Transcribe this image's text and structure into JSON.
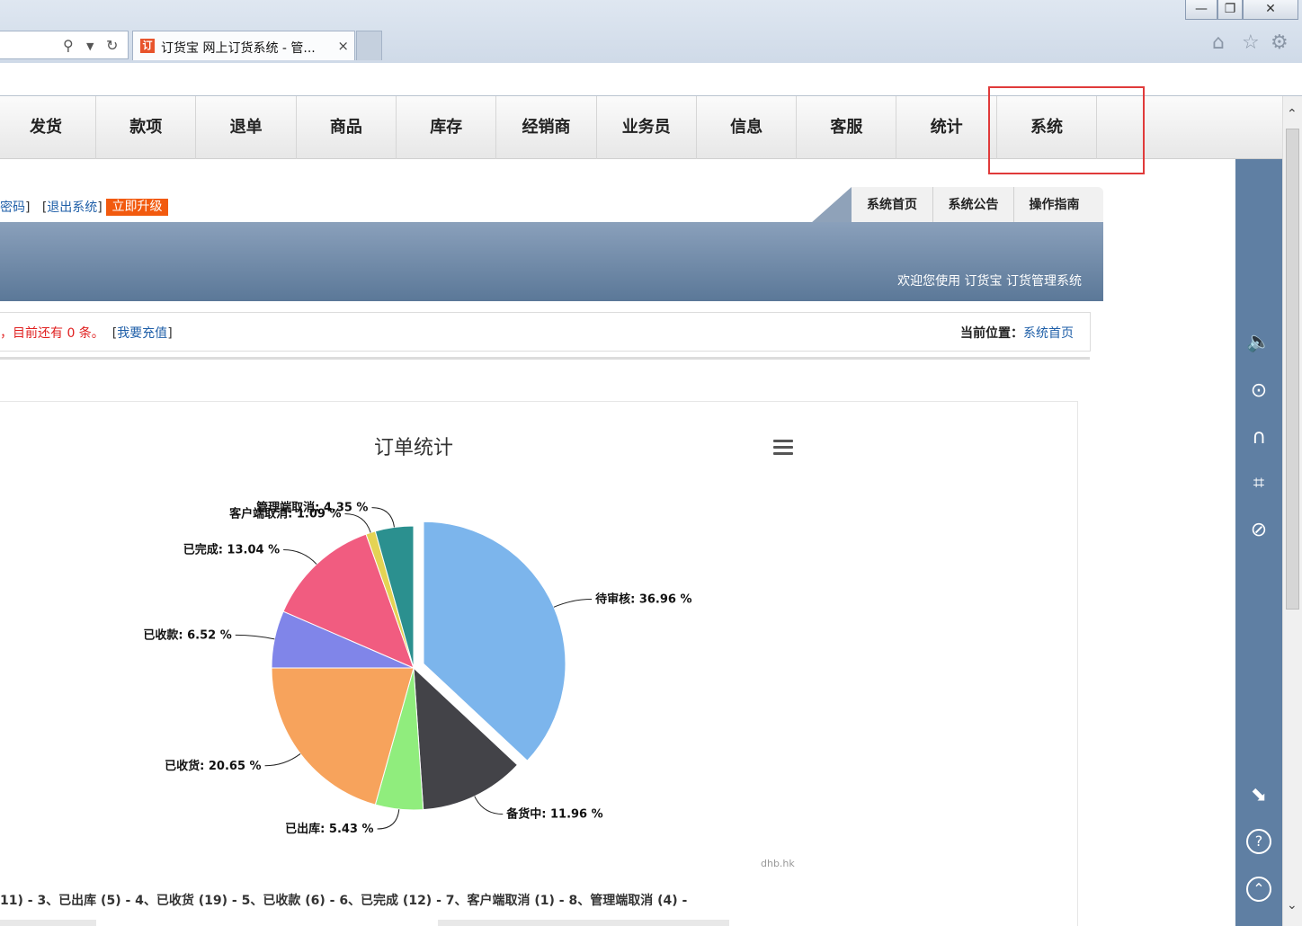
{
  "browser": {
    "tab_title": "订货宝 网上订货系统 - 管...",
    "tab_favicon": "订",
    "close_glyph": "×",
    "minimize_glyph": "—",
    "restore_glyph": "❐",
    "closewin_glyph": "✕",
    "icons": [
      "home-icon",
      "star-icon",
      "gear-icon",
      "search-icon",
      "refresh-icon"
    ]
  },
  "nav": {
    "items": [
      "发货",
      "款项",
      "退单",
      "商品",
      "库存",
      "经销商",
      "业务员",
      "信息",
      "客服",
      "统计",
      "系统"
    ],
    "highlighted": "系统"
  },
  "topbar": {
    "link_password": "密码",
    "link_logout": "退出系统",
    "upgrade": "立即升级",
    "tabs": [
      "系统首页",
      "系统公告",
      "操作指南"
    ]
  },
  "banner": {
    "welcome": "欢迎您使用 订货宝 订货管理系统"
  },
  "notice": {
    "left_text": "，目前还有 0 条。",
    "recharge": "我要充值",
    "location_label": "当前位置：",
    "location_value": "系统首页"
  },
  "chart_data": {
    "type": "pie",
    "title": "订单统计",
    "slices": [
      {
        "name": "待审核",
        "label": "待审核: 36.96 %",
        "value": 36.96,
        "color": "#7cb5ec",
        "sliced": true
      },
      {
        "name": "备货中",
        "label": "备货中: 11.96 %",
        "value": 11.96,
        "color": "#434348"
      },
      {
        "name": "已出库",
        "label": "已出库: 5.43 %",
        "value": 5.43,
        "color": "#90ed7d"
      },
      {
        "name": "已收货",
        "label": "已收货: 20.65 %",
        "value": 20.65,
        "color": "#f7a35c"
      },
      {
        "name": "已收款",
        "label": "已收款: 6.52 %",
        "value": 6.52,
        "color": "#8085e9"
      },
      {
        "name": "已完成",
        "label": "已完成: 13.04 %",
        "value": 13.04,
        "color": "#f15c80"
      },
      {
        "name": "客户端取消",
        "label": "客户端取消: 1.09 %",
        "value": 1.09,
        "color": "#e4d354"
      },
      {
        "name": "管理端取消",
        "label": "管理端取消: 4.35 %",
        "value": 4.35,
        "color": "#2b908f"
      }
    ],
    "credit": "dhb.hk"
  },
  "legend_text": "11)  -  3、已出库 (5)  -  4、已收货 (19)  -  5、已收款 (6)  -  6、已完成 (12)  -  7、客户端取消 (1)  -  8、管理端取消 (4)  -",
  "sidepanel_icons": [
    "speaker-icon",
    "settings-icon",
    "headset-icon",
    "scan-icon",
    "compass-icon",
    "export-icon",
    "help-icon",
    "back-to-top-icon"
  ]
}
